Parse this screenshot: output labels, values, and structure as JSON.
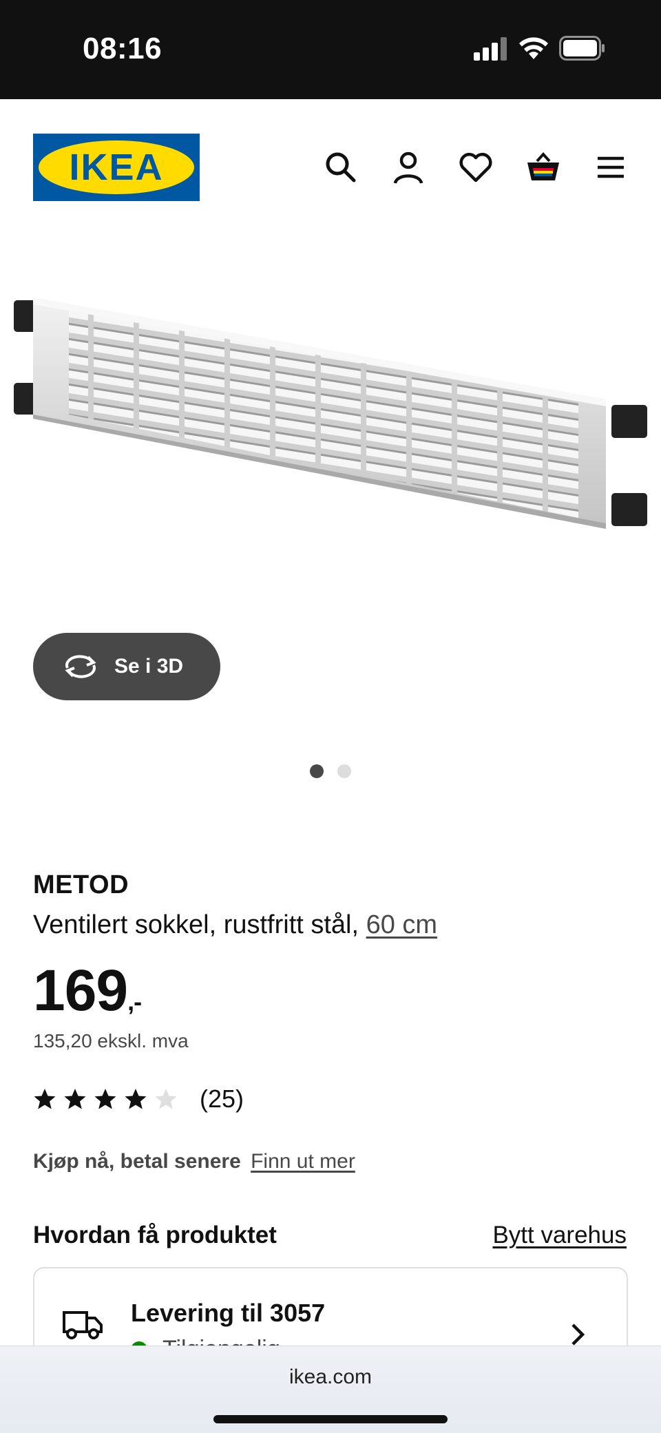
{
  "status_bar": {
    "time": "08:16"
  },
  "header": {
    "logo_text": "IKEA",
    "icons": [
      "search-icon",
      "profile-icon",
      "heart-icon",
      "cart-icon",
      "menu-icon"
    ]
  },
  "gallery": {
    "view_3d_label": "Se i 3D",
    "slide_count": 2,
    "active_slide": 1
  },
  "product": {
    "brand": "METOD",
    "description": "Ventilert sokkel, rustfritt stål, ",
    "size_link": "60 cm",
    "price": "169",
    "price_suffix": ",-",
    "price_ex_vat": "135,20 ekskl. mva",
    "rating": {
      "value": 4,
      "max": 5,
      "count_label": "(25)"
    },
    "pay_later": {
      "label": "Kjøp nå, betal senere",
      "link": "Finn ut mer"
    }
  },
  "delivery": {
    "section_title": "Hvordan få produktet",
    "change_store_link": "Bytt varehus",
    "card_title": "Levering til 3057",
    "card_status": "Tilgjengelig"
  },
  "browser": {
    "url": "ikea.com"
  },
  "colors": {
    "ikea_blue": "#0058a3",
    "ikea_yellow": "#ffdb00",
    "available_green": "#0a8a00",
    "button_dark": "#484848"
  }
}
